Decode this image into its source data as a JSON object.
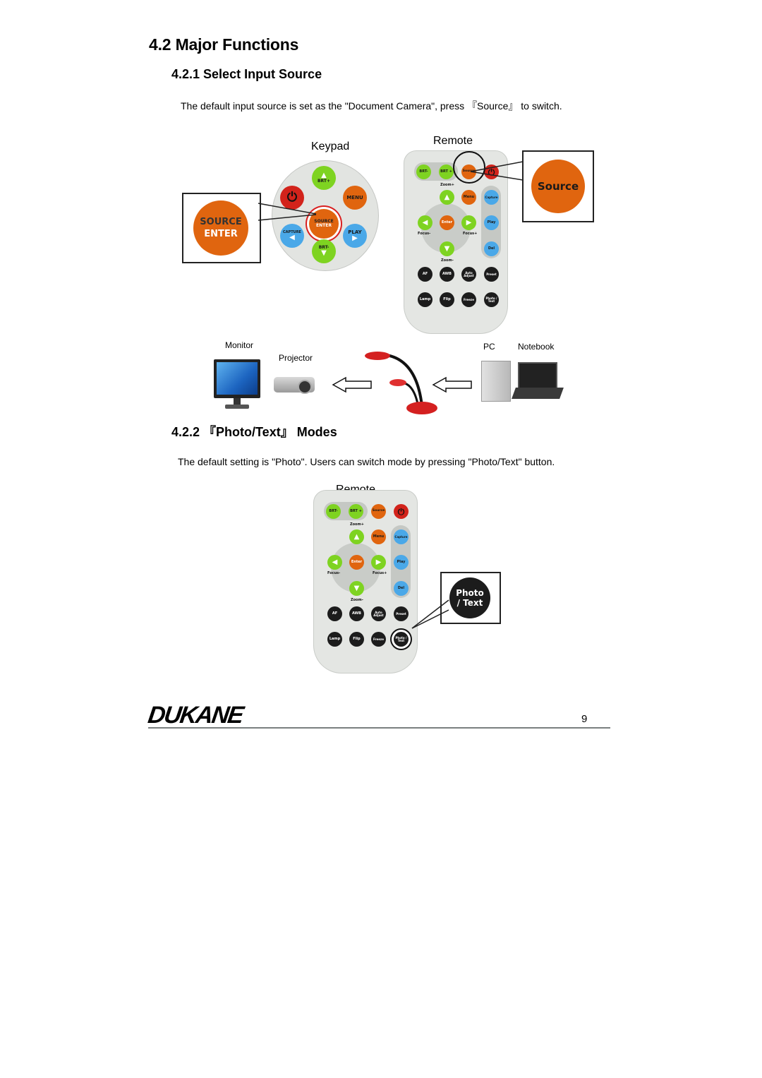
{
  "page": {
    "heading": "4.2  Major Functions",
    "page_number": "9",
    "footer_logo": "DUKANE"
  },
  "section_421": {
    "heading": "4.2.1  Select Input Source",
    "body": "The default input source is set as the \"Document Camera\", press 『Source』 to switch.",
    "keypad_label": "Keypad",
    "remote_label": "Remote",
    "keypad": {
      "buttons": [
        "BRT+",
        "MENU",
        "PLAY",
        "BRT-",
        "CAPTURE",
        "SOURCE ENTER"
      ],
      "callout_line1": "SOURCE",
      "callout_line2": "ENTER"
    },
    "remote_callout": "Source",
    "diagram": {
      "outputs": [
        "Monitor",
        "Projector"
      ],
      "inputs": [
        "PC",
        "Notebook"
      ]
    }
  },
  "section_422": {
    "heading": "4.2.2 『Photo/Text』 Modes",
    "body": "The default setting is \"Photo\". Users can switch mode by pressing \"Photo/Text\" button.",
    "remote_label": "Remote",
    "callout_line1": "Photo",
    "callout_line2": "/ Text"
  },
  "remote": {
    "top_row": [
      "BRT-",
      "BRT +",
      "Source"
    ],
    "zoom_plus": "Zoom+",
    "zoom_minus": "Zoom-",
    "focus_minus": "Focus-",
    "focus_plus": "Focus+",
    "menu": "Menu",
    "enter": "Enter",
    "side": [
      "Capture",
      "Play",
      "Del"
    ],
    "row1": [
      "AF",
      "AWB",
      "Auto Adjust",
      "Preset"
    ],
    "row2": [
      "Lamp",
      "Flip",
      "Freeze",
      "Photo / Text"
    ]
  }
}
